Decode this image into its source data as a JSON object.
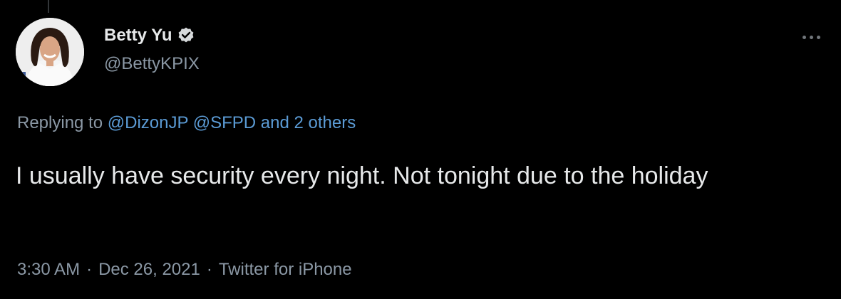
{
  "author": {
    "display_name": "Betty Yu",
    "handle": "@BettyKPIX",
    "verified_icon": "verified-badge-icon",
    "avatar": "profile-photo"
  },
  "reply_context": {
    "prefix": "Replying to",
    "mentions": [
      "@DizonJP",
      "@SFPD"
    ],
    "others": "and 2 others"
  },
  "tweet": {
    "text": "I usually have security every night. Not tonight due to the holiday"
  },
  "meta": {
    "time": "3:30 AM",
    "separator": "·",
    "date": "Dec 26, 2021",
    "source": "Twitter for iPhone"
  },
  "actions": {
    "more_icon": "more-options-icon"
  },
  "colors": {
    "background": "#000000",
    "text": "#e7e9ea",
    "secondary": "#8b98a5",
    "link": "#5b9bd5"
  }
}
